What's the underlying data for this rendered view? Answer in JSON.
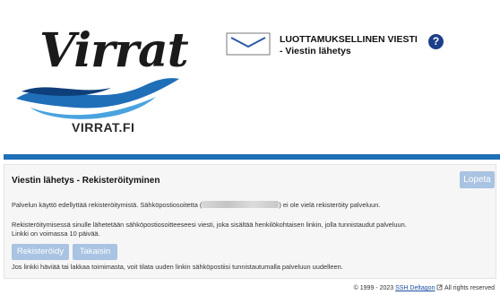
{
  "logo": {
    "script_text": "Virrat",
    "url_text": "VIRRAT.FI",
    "icon": "virrat-logo"
  },
  "header": {
    "envelope_icon": "envelope-icon",
    "title": "LUOTTAMUKSELLINEN VIESTI",
    "subtitle": "- Viestin lähetys",
    "help_label": "?"
  },
  "colors": {
    "brand_blue": "#1f6fb8",
    "button_disabled": "#a9c3e2",
    "help_blue": "#1d3f8a"
  },
  "panel": {
    "title": "Viestin lähetys - Rekisteröityminen",
    "lopeta_label": "Lopeta",
    "p1_before": "Palvelun käyttö edellyttää rekisteröitymistä. Sähköpostiosoitetta (",
    "p1_after": ") ei ole vielä rekisteröity palveluun.",
    "p2_line1": "Rekisteröitymisessä sinulle lähetetään sähköpostiosoitteeseesi viesti, joka sisältää henkilökohtaisen linkin, jolla tunnistaudut palveluun.",
    "p2_line2": "Linkki on voimassa 10 päivää.",
    "register_label": "Rekisteröidy",
    "back_label": "Takaisin",
    "p3": "Jos linkki häviää tai lakkaa toimimasta, voit tilata uuden linkin sähköpostiisi tunnistautumalla palveluun uudelleen."
  },
  "footer": {
    "before": "© 1999 - 2023 ",
    "link": "SSH Deltagon",
    "after": " All rights reserved"
  }
}
